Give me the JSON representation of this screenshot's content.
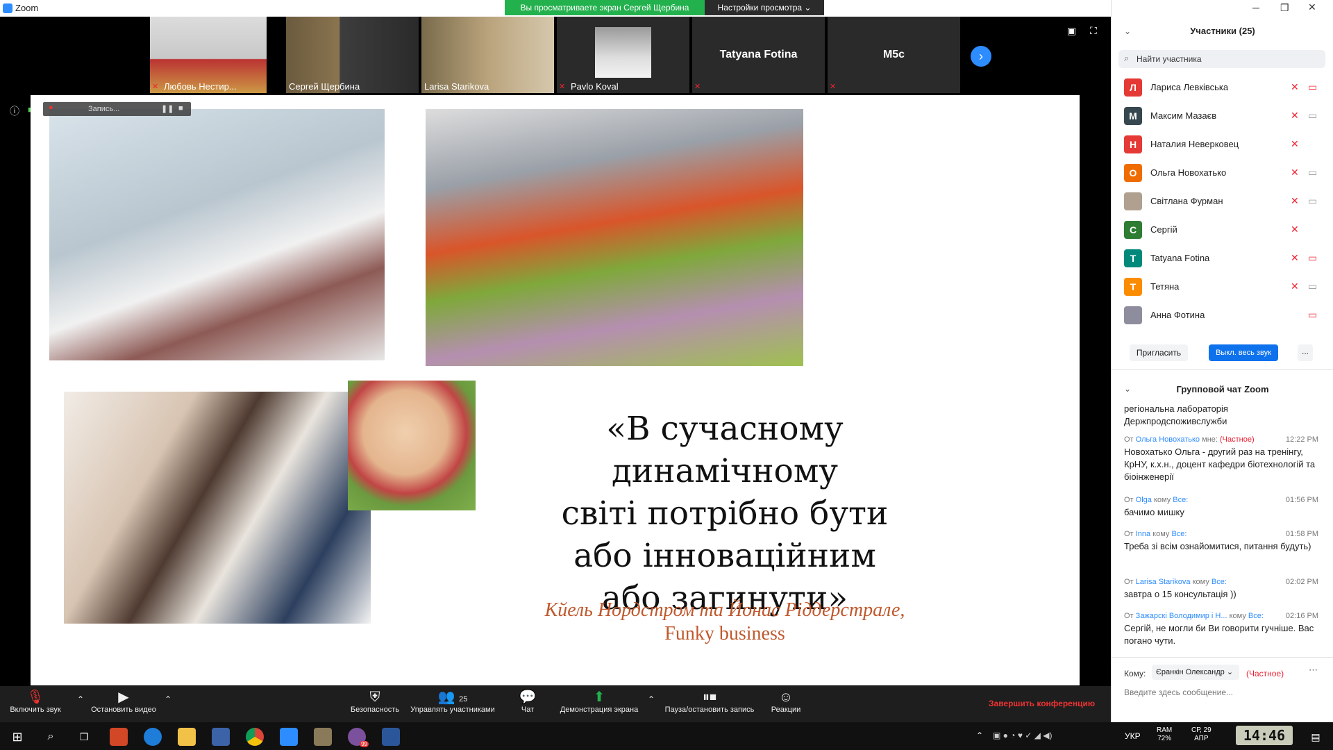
{
  "titlebar": {
    "app_title": "Zoom"
  },
  "banners": {
    "viewing": "Вы просматриваете экран Сергей Щербина",
    "view_settings": "Настройки просмотра ⌄"
  },
  "thumbnails": [
    {
      "name": "Любовь Нестир..."
    },
    {
      "name": "Сергей Щербина"
    },
    {
      "name": "Larisa Starikova"
    },
    {
      "name": "Pavlo Koval"
    },
    {
      "name": "Tatyana Fotina"
    },
    {
      "name": "M5c"
    }
  ],
  "recording": {
    "label": "Запись..."
  },
  "slide": {
    "quote_lines": [
      "«В сучасному динамічному",
      "світі потрібно бути",
      "або інноваційним",
      "або загинути»"
    ],
    "author_lines": [
      "Кйель Нордстром та Йонас Ріддерстрале,",
      "Funky business"
    ]
  },
  "panel": {
    "participants_title": "Участники (25)",
    "search_placeholder": "Найти участника",
    "participants": [
      {
        "initial": "Л",
        "name": "Лариса Левківська",
        "color": "#e53935"
      },
      {
        "initial": "М",
        "name": "Максим Мазаєв",
        "color": "#37474f"
      },
      {
        "initial": "Н",
        "name": "Наталия Неверковец",
        "color": "#e53935"
      },
      {
        "initial": "О",
        "name": "Ольга Новохатько",
        "color": "#ef6c00"
      },
      {
        "initial": "",
        "name": "Світлана Фурман",
        "color": "#b0a090"
      },
      {
        "initial": "С",
        "name": "Сергій",
        "color": "#2e7d32"
      },
      {
        "initial": "T",
        "name": "Tatyana Fotina",
        "color": "#00897b"
      },
      {
        "initial": "Т",
        "name": "Тетяна",
        "color": "#fb8c00"
      },
      {
        "initial": "",
        "name": "Анна Фотина",
        "color": "#8d8d9d"
      }
    ],
    "invite": "Пригласить",
    "mute_all": "Выкл. весь звук",
    "more": "...",
    "chat_title": "Групповой чат Zoom",
    "chat_top": "регіональна лабораторія Держпродспоживслужби",
    "messages": [
      {
        "from": "Ольга Новохатько",
        "to": "мне:",
        "tag": "(Частное)",
        "time": "12:22 PM",
        "text": "Новохатько Ольга - другий раз на тренінгу, КрНУ, к.х.н., доцент кафедри біотехнологій та біоінженерії"
      },
      {
        "from": "Olga",
        "to": "Все:",
        "tag": "",
        "time": "01:56 PM",
        "text": "бачимо мишку"
      },
      {
        "from": "Inna",
        "to": "Все:",
        "tag": "",
        "time": "01:58 PM",
        "text": "Треба зі всім ознайомитися, питання будуть)"
      },
      {
        "from": "Larisa Starikova",
        "to": "Все:",
        "tag": "",
        "time": "02:02 PM",
        "text": "завтра о 15 консультація ))"
      },
      {
        "from": "Зажарскі Володимир і Н...",
        "to": "Все:",
        "tag": "",
        "time": "02:16 PM",
        "text": "Сергій, не могли би Ви говорити гучніше. Вас погано чути."
      }
    ],
    "from_prefix": "От",
    "to_word": "кому",
    "to_label": "Кому:",
    "recipient": "Єранкін Олександр",
    "recipient_tag": "(Частное)",
    "message_placeholder": "Введите здесь сообщение..."
  },
  "toolbar": {
    "unmute": "Включить звук",
    "stop_video": "Остановить видео",
    "security": "Безопасность",
    "participants": "Управлять участниками",
    "participants_count": "25",
    "chat": "Чат",
    "share": "Демонстрация экрана",
    "record": "Пауза/остановить запись",
    "reactions": "Реакции",
    "end": "Завершить конференцию"
  },
  "taskbar": {
    "lang": "УКР",
    "ram_label": "RAM",
    "ram_value": "72%",
    "date1": "СР, 29",
    "date2": "АПР",
    "clock": "14:46",
    "badge": "99"
  }
}
